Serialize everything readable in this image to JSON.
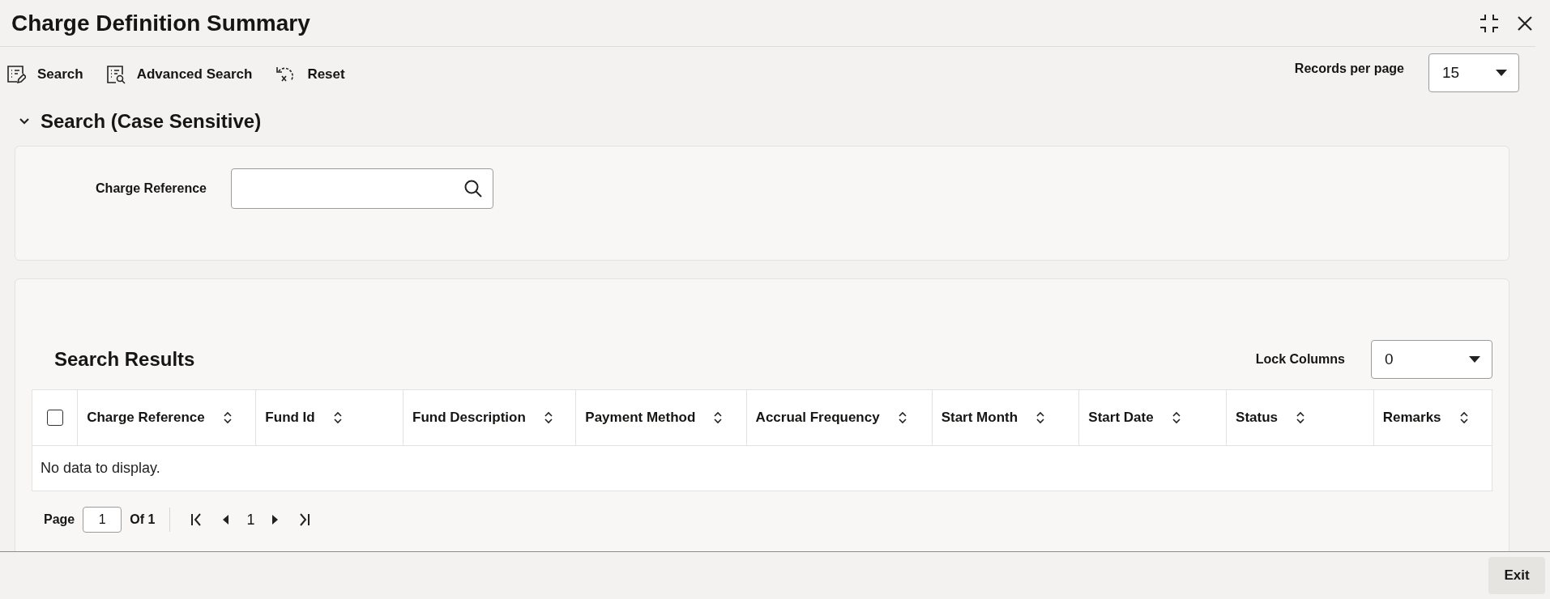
{
  "window": {
    "title": "Charge Definition Summary"
  },
  "toolbar": [
    {
      "kind": "search",
      "label": "Search"
    },
    {
      "kind": "advanced",
      "label": "Advanced Search"
    },
    {
      "kind": "reset",
      "label": "Reset"
    }
  ],
  "records_per_page": {
    "label": "Records per page",
    "value": "15"
  },
  "search_section": {
    "title": "Search (Case Sensitive)",
    "expanded": true,
    "fields": [
      {
        "label": "Charge Reference"
      }
    ]
  },
  "results": {
    "title": "Search Results",
    "lock_columns": {
      "label": "Lock Columns",
      "value": "0"
    },
    "select_all_checked": false,
    "columns": [
      "Charge Reference",
      "Fund Id",
      "Fund Description",
      "Payment Method",
      "Accrual Frequency",
      "Start Month",
      "Start Date",
      "Status",
      "Remarks"
    ],
    "empty_message": "No data to display."
  },
  "pagination": {
    "page_label": "Page",
    "page_value": "1",
    "of_label": "Of 1",
    "current": "1"
  },
  "footer": {
    "buttons": [
      "Exit"
    ]
  }
}
